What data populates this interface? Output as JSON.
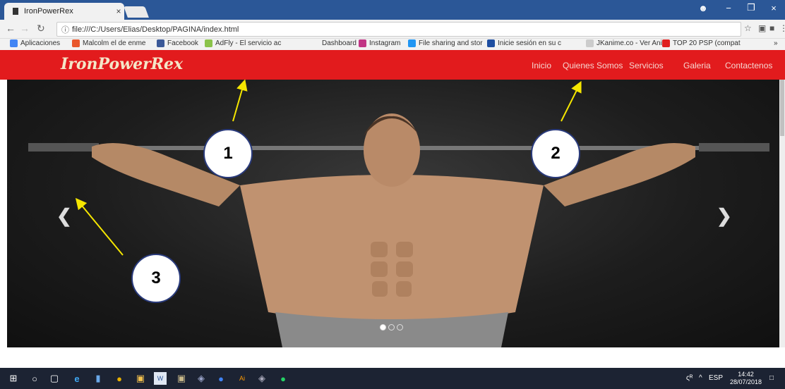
{
  "browser": {
    "tab_title": "IronPowerRex",
    "tab_close": "×",
    "url": "file:///C:/Users/Elias/Desktop/PAGINA/index.html",
    "window_controls": [
      "−",
      "❐",
      "×"
    ]
  },
  "bookmarks": [
    {
      "label": "Aplicaciones",
      "color": "#4285f4"
    },
    {
      "label": "Malcolm el de enme",
      "color": "#e9572c"
    },
    {
      "label": "Facebook",
      "color": "#3b5998"
    },
    {
      "label": "AdFly - El servicio ac",
      "color": "#8bc34a"
    },
    {
      "label": "Dashboard",
      "color": "#bbbbbb"
    },
    {
      "label": "Instagram",
      "color": "#c13584"
    },
    {
      "label": "File sharing and stor",
      "color": "#2196f3"
    },
    {
      "label": "Inicie sesión en su c",
      "color": "#1e4ea1"
    },
    {
      "label": "JKanime.co - Ver Ani",
      "color": "#cccccc"
    },
    {
      "label": "TOP 20 PSP (compat",
      "color": "#e02020"
    }
  ],
  "site": {
    "brand": "IronPowerRex",
    "menu": [
      "Inicio",
      "Quienes Somos",
      "Servicios",
      "Galeria",
      "Contactenos"
    ],
    "carousel": {
      "prev": "❮",
      "next": "❯",
      "slide_count": 3,
      "active_slide": 1
    }
  },
  "annotations": [
    "1",
    "2",
    "3"
  ],
  "taskbar": {
    "lang": "ESP",
    "time": "14:42",
    "date": "28/07/2018"
  },
  "colors": {
    "navbar": "#e21b1d",
    "arrow": "#f5e600"
  }
}
